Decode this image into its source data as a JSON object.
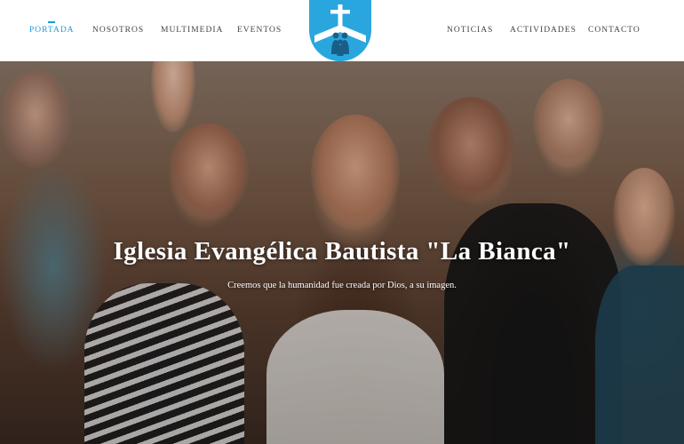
{
  "nav": {
    "left": [
      {
        "label": "PORTADA",
        "active": true
      },
      {
        "label": "NOSOTROS",
        "active": false
      },
      {
        "label": "MULTIMEDIA",
        "active": false
      },
      {
        "label": "EVENTOS",
        "active": false
      }
    ],
    "right": [
      {
        "label": "NOTICIAS",
        "active": false
      },
      {
        "label": "ACTIVIDADES",
        "active": false
      },
      {
        "label": "CONTACTO",
        "active": false
      }
    ],
    "logo_icon": "church-cross-family-logo"
  },
  "hero": {
    "title": "Iglesia Evangélica Bautista \"La Bianca\"",
    "subtitle": "Creemos que la humanidad fue creada por Dios, a su imagen."
  },
  "colors": {
    "accent": "#1e9ad6",
    "logo_circle": "#2aa6df",
    "nav_text": "#444444",
    "hero_text": "#ffffff"
  }
}
